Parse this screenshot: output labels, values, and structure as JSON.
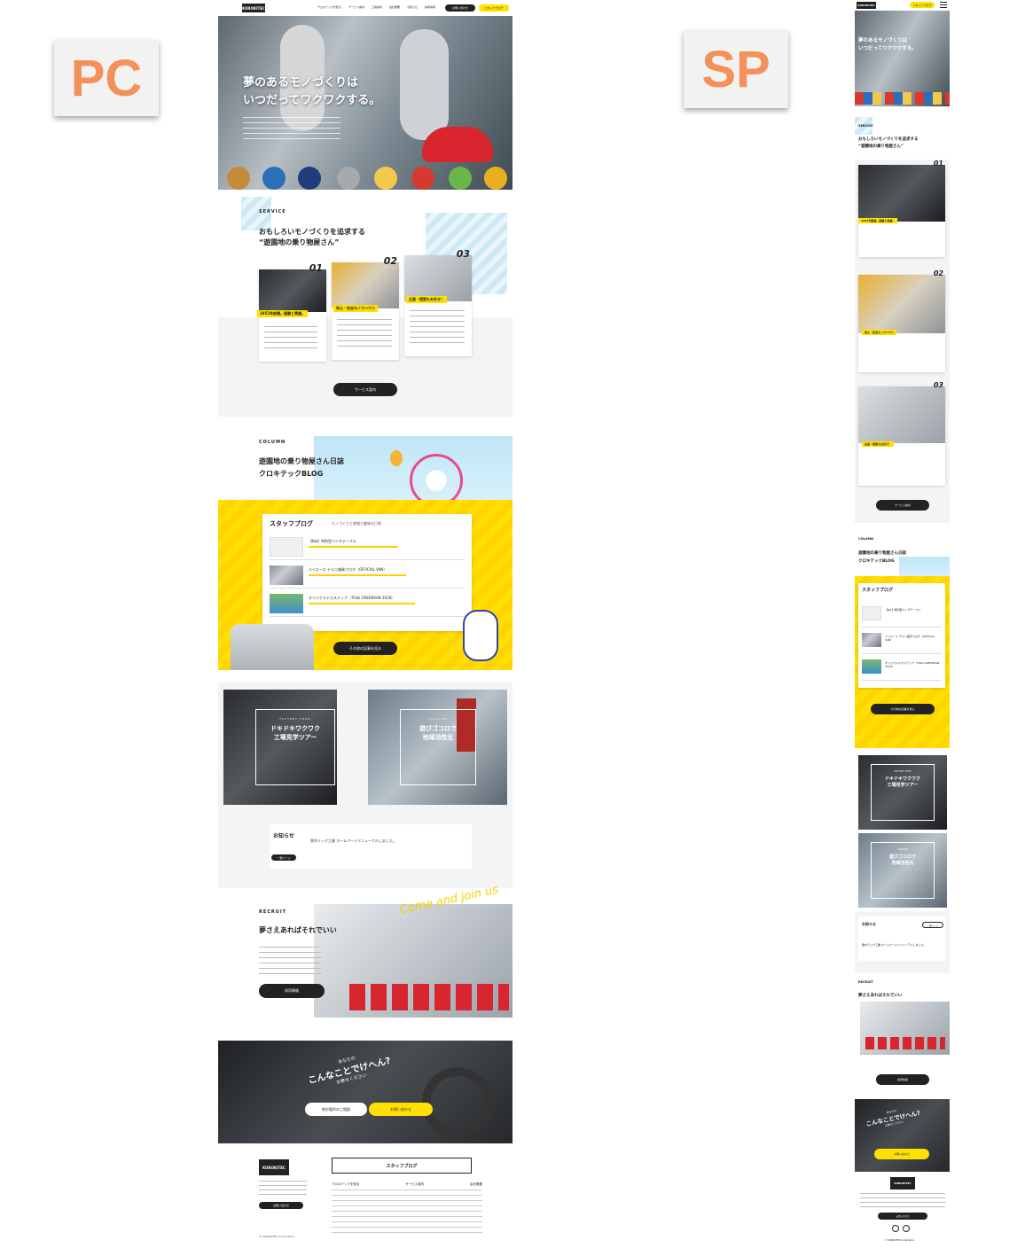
{
  "labels": {
    "pc": "PC",
    "sp": "SP"
  },
  "header": {
    "logo": "KUROKITEC",
    "nav": [
      "クロキテックを知る",
      "サービス案内",
      "工場案内",
      "会社概要",
      "お知らせ",
      "採用情報"
    ],
    "contact": "お問い合わせ",
    "blog": "スタッフブログ"
  },
  "hero": {
    "line1": "夢のあるモノづくりは",
    "line2": "いつだってワクワクする。"
  },
  "service": {
    "eyebrow": "SERVICE",
    "title1": "おもしろいモノづくりを追求する",
    "title2": "“遊園地の乗り物屋さん”",
    "cards": [
      {
        "no": "01",
        "badge": "1952年創業。経験と実績。"
      },
      {
        "no": "02",
        "badge": "安心・安全のノウハウ☺"
      },
      {
        "no": "03",
        "badge": "企画・提案もお任せ！"
      }
    ],
    "button": "サービス案内"
  },
  "column": {
    "eyebrow": "COLUMN",
    "title1": "遊園地の乗り物屋さん日誌",
    "title2": "クロキテックBLOG",
    "blog_title": "スタッフブログ",
    "blog_sub": "モノづくりと地域と趣味な日常",
    "posts": [
      "【Bw】特別型ベンチテーブル",
      "ハイエース デルニ雑貨ブログ（OFFICIAL VAN）",
      "オリジナルドカステップ（7Falli GREENVAN 2018）"
    ],
    "button": "その他の記事を見る"
  },
  "features": [
    {
      "eyebrow": "FACTORY TOUR",
      "title1": "ドキドキワクワク",
      "title2": "工場見学ツアー"
    },
    {
      "eyebrow": "VITALIZE",
      "title1": "遊びゴコロで",
      "title2": "地域活性化"
    }
  ],
  "news": {
    "title": "お知らせ",
    "item": "黒木テック工業 ホームページリニューアルしました。",
    "button": "一覧ページ"
  },
  "recruit": {
    "eyebrow": "RECRUIT",
    "title": "夢さえあればそれでいい",
    "script": "Come and join us",
    "button": "採用情報"
  },
  "cta": {
    "line1": "あなたの",
    "line2": "こんなことでけへん?",
    "line3": "お寄せください",
    "btn1": "物お製作のご相談",
    "btn2": "お問い合わせ"
  },
  "footer": {
    "logo": "KUROKITEC",
    "blog": "スタッフブログ",
    "cols": [
      "クロキテックを知る",
      "サービス案内",
      "会社概要"
    ],
    "copy": "© KUROKITEC Corporation"
  },
  "colors": {
    "yellow": "#ffe000",
    "dark": "#222222",
    "accent": "#f4915a",
    "lightgray": "#f4f4f4"
  }
}
